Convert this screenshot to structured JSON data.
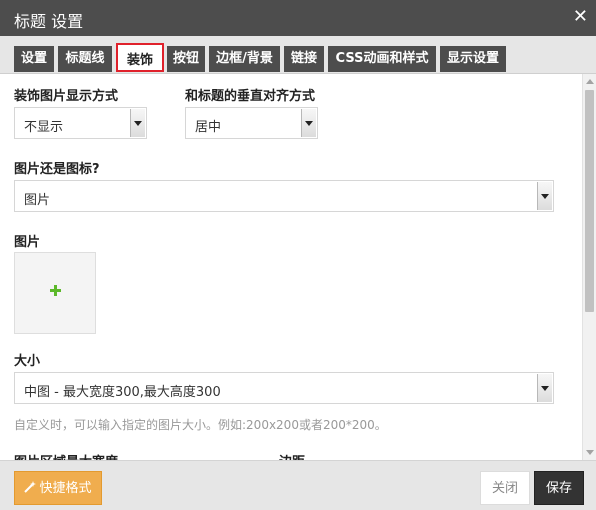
{
  "dialog": {
    "title": "标题 设置",
    "close_glyph": "✕"
  },
  "tabs": [
    {
      "label": "设置",
      "active": false
    },
    {
      "label": "标题线",
      "active": false
    },
    {
      "label": "装饰",
      "active": true
    },
    {
      "label": "按钮",
      "active": false
    },
    {
      "label": "边框/背景",
      "active": false
    },
    {
      "label": "链接",
      "active": false
    },
    {
      "label": "CSS动画和样式",
      "active": false
    },
    {
      "label": "显示设置",
      "active": false
    }
  ],
  "form": {
    "display_mode": {
      "label": "装饰图片显示方式",
      "value": "不显示"
    },
    "vertical_align": {
      "label": "和标题的垂直对齐方式",
      "value": "居中"
    },
    "image_or_icon": {
      "label": "图片还是图标?",
      "value": "图片"
    },
    "image": {
      "label": "图片"
    },
    "size": {
      "label": "大小",
      "value": "中图 - 最大宽度300,最大高度300",
      "hint": "自定义时，可以输入指定的图片大小。例如:200x200或者200*200。"
    },
    "partial_labels": {
      "max_width": "图片区域最大宽度",
      "margin": "边距"
    }
  },
  "footer": {
    "quick_format_label": "快捷格式",
    "close_label": "关闭",
    "save_label": "保存"
  },
  "colors": {
    "titlebar": "#4d4d4d",
    "tab_bg": "#4d4d4d",
    "active_tab_border": "#e0212b",
    "quick_button": "#f0ad4e",
    "save_button": "#333333",
    "plus_icon": "#5cb82a"
  },
  "icons": {
    "add_image": "plus-icon",
    "quick_format": "magic-wand-icon",
    "close": "close-icon"
  }
}
